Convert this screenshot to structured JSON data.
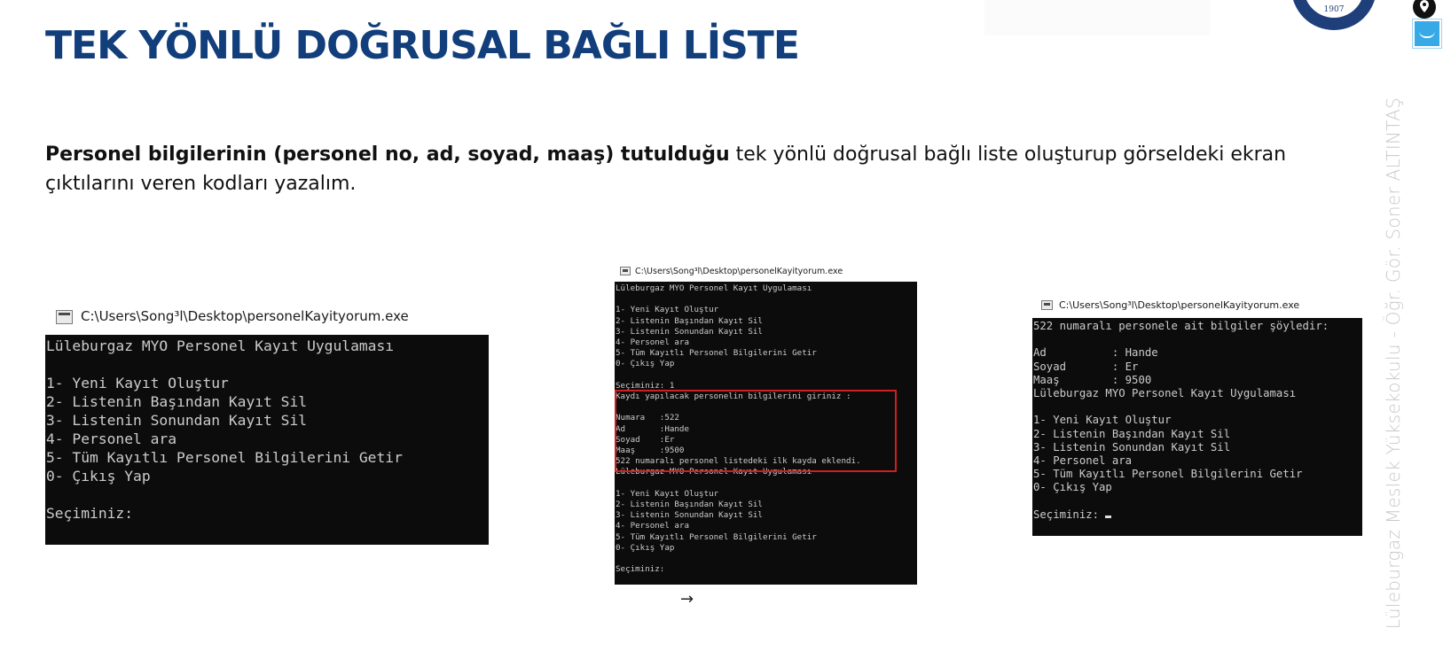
{
  "slide": {
    "title": "TEK YÖNLÜ DOĞRUSAL BAĞLI LİSTE",
    "description_bold": "Personel bilgilerinin (personel no, ad, soyad, maaş) tutulduğu",
    "description_rest": " tek yönlü doğrusal bağlı liste oluşturup görseldeki ekran çıktılarını veren kodları yazalım.",
    "side_text": "Lüleburgaz Meslek Yüksekokulu - Öğr. Gör. Soner ALTINTAŞ",
    "logo_text": "1907",
    "accent_color": "#123e7c"
  },
  "windows": [
    {
      "title": "C:\\Users\\Song³l\\Desktop\\personelKayityorum.exe",
      "lines": [
        "Lüleburgaz MYO Personel Kayıt Uygulaması",
        "",
        "1- Yeni Kayıt Oluştur",
        "2- Listenin Başından Kayıt Sil",
        "3- Listenin Sonundan Kayıt Sil",
        "4- Personel ara",
        "5- Tüm Kayıtlı Personel Bilgilerini Getir",
        "0- Çıkış Yap",
        "",
        "Seçiminiz:"
      ]
    },
    {
      "title": "C:\\Users\\Song³l\\Desktop\\personelKayityorum.exe",
      "lines": [
        "Lüleburgaz MYO Personel Kayıt Uygulaması",
        "",
        "1- Yeni Kayıt Oluştur",
        "2- Listenin Başından Kayıt Sil",
        "3- Listenin Sonundan Kayıt Sil",
        "4- Personel ara",
        "5- Tüm Kayıtlı Personel Bilgilerini Getir",
        "0- Çıkış Yap",
        "",
        "Seçiminiz: 1",
        "Kaydı yapılacak personelin bilgilerini giriniz :",
        "",
        "Numara   :522",
        "Ad       :Hande",
        "Soyad    :Er",
        "Maaş     :9500",
        "522 numaralı personel listedeki ilk kayda eklendi.",
        "Lüleburgaz MYO Personel Kayıt Uygulaması",
        "",
        "1- Yeni Kayıt Oluştur",
        "2- Listenin Başından Kayıt Sil",
        "3- Listenin Sonundan Kayıt Sil",
        "4- Personel ara",
        "5- Tüm Kayıtlı Personel Bilgilerini Getir",
        "0- Çıkış Yap",
        "",
        "Seçiminiz:"
      ]
    },
    {
      "title": "C:\\Users\\Song³l\\Desktop\\personelKayityorum.exe",
      "lines": [
        "522 numaralı personele ait bilgiler şöyledir:",
        "",
        "Ad          : Hande",
        "Soyad       : Er",
        "Maaş        : 9500",
        "Lüleburgaz MYO Personel Kayıt Uygulaması",
        "",
        "1- Yeni Kayıt Oluştur",
        "2- Listenin Başından Kayıt Sil",
        "3- Listenin Sonundan Kayıt Sil",
        "4- Personel ara",
        "5- Tüm Kayıtlı Personel Bilgilerini Getir",
        "0- Çıkış Yap",
        "",
        "Seçiminiz: "
      ]
    }
  ],
  "icons": {
    "pin": "pin-icon",
    "note": "note-icon",
    "arrow": "arrow-right-icon",
    "window": "console-window-icon"
  }
}
